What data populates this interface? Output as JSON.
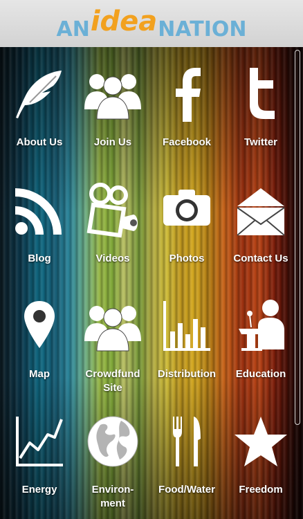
{
  "header": {
    "logo_part1": "AN",
    "logo_part2": "idea",
    "logo_part3": "NATION"
  },
  "tiles": [
    {
      "label": "About Us",
      "icon": "feather-icon"
    },
    {
      "label": "Join Us",
      "icon": "group-icon"
    },
    {
      "label": "Facebook",
      "icon": "facebook-icon"
    },
    {
      "label": "Twitter",
      "icon": "twitter-icon"
    },
    {
      "label": "Blog",
      "icon": "rss-icon"
    },
    {
      "label": "Videos",
      "icon": "video-camera-icon"
    },
    {
      "label": "Photos",
      "icon": "camera-icon"
    },
    {
      "label": "Contact Us",
      "icon": "envelope-icon"
    },
    {
      "label": "Map",
      "icon": "map-pin-icon"
    },
    {
      "label": "Crowdfund Site",
      "icon": "group-icon"
    },
    {
      "label": "Distribution",
      "icon": "bar-chart-icon"
    },
    {
      "label": "Education",
      "icon": "speaker-podium-icon"
    },
    {
      "label": "Energy",
      "icon": "line-chart-icon"
    },
    {
      "label": "Environ- ment",
      "icon": "globe-icon"
    },
    {
      "label": "Food/Water",
      "icon": "fork-knife-icon"
    },
    {
      "label": "Freedom",
      "icon": "star-icon"
    }
  ],
  "colors": {
    "logo_blue": "#6bb0d6",
    "logo_orange": "#f2a11f",
    "header_bg": "#dcdcdc",
    "icon_white": "#ffffff"
  }
}
